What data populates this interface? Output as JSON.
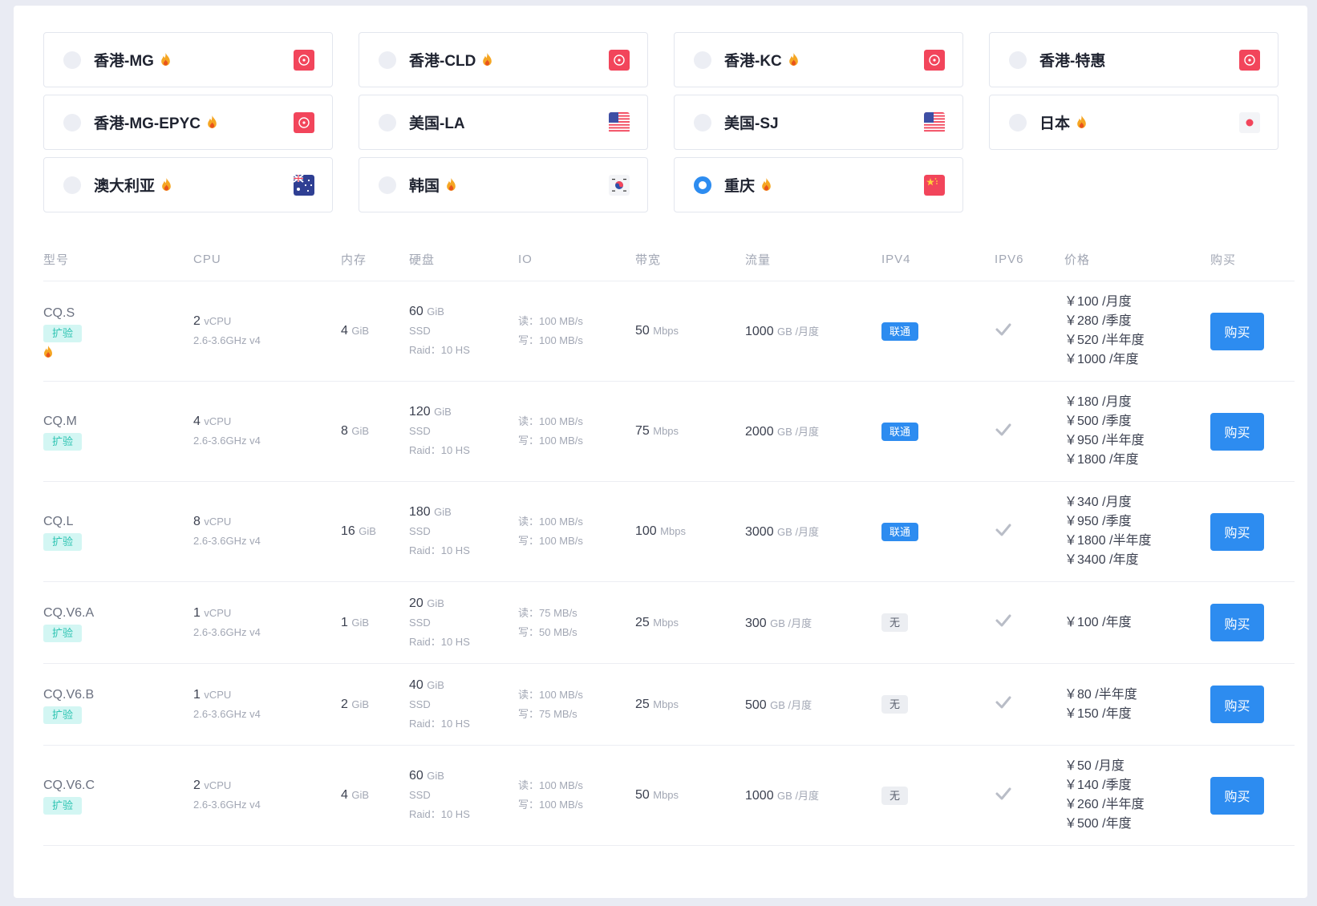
{
  "regions": [
    {
      "name": "香港-MG",
      "hot": true,
      "flag": "hk",
      "checked": false
    },
    {
      "name": "香港-CLD",
      "hot": true,
      "flag": "hk",
      "checked": false
    },
    {
      "name": "香港-KC",
      "hot": true,
      "flag": "hk",
      "checked": false
    },
    {
      "name": "香港-特惠",
      "hot": false,
      "flag": "hk",
      "checked": false
    },
    {
      "name": "香港-MG-EPYC",
      "hot": true,
      "flag": "hk",
      "checked": false
    },
    {
      "name": "美国-LA",
      "hot": false,
      "flag": "us",
      "checked": false
    },
    {
      "name": "美国-SJ",
      "hot": false,
      "flag": "us",
      "checked": false
    },
    {
      "name": "日本",
      "hot": true,
      "flag": "jp",
      "checked": false
    },
    {
      "name": "澳大利亚",
      "hot": true,
      "flag": "au",
      "checked": false
    },
    {
      "name": "韩国",
      "hot": true,
      "flag": "kr",
      "checked": false
    },
    {
      "name": "重庆",
      "hot": true,
      "flag": "cn",
      "checked": true
    }
  ],
  "headers": {
    "model": "型号",
    "cpu": "CPU",
    "mem": "内存",
    "disk": "硬盘",
    "io": "IO",
    "bw": "带宽",
    "traffic": "流量",
    "ipv4": "IPV4",
    "ipv6": "IPV6",
    "price": "价格",
    "buy": "购买"
  },
  "plans": [
    {
      "model": "CQ.S",
      "tag": "扩验",
      "hot": true,
      "cpu": "2",
      "cpu_unit": "vCPU",
      "cpu_freq": "2.6-3.6GHz v4",
      "mem": "4",
      "mem_unit": "GiB",
      "disk": "60",
      "disk_unit": "GiB",
      "disk_type": "SSD",
      "raid": "Raid：10 HS",
      "io_read": "读：100 MB/s",
      "io_write": "写：100 MB/s",
      "bw": "50",
      "bw_unit": "Mbps",
      "traffic": "1000",
      "traffic_unit": "GB /月度",
      "ipv4": "联通",
      "ipv4_type": "isp",
      "ipv6": true,
      "prices": [
        "￥100 /月度",
        "￥280 /季度",
        "￥520 /半年度",
        "￥1000 /年度"
      ],
      "buy": "购买"
    },
    {
      "model": "CQ.M",
      "tag": "扩验",
      "hot": false,
      "cpu": "4",
      "cpu_unit": "vCPU",
      "cpu_freq": "2.6-3.6GHz v4",
      "mem": "8",
      "mem_unit": "GiB",
      "disk": "120",
      "disk_unit": "GiB",
      "disk_type": "SSD",
      "raid": "Raid：10 HS",
      "io_read": "读：100 MB/s",
      "io_write": "写：100 MB/s",
      "bw": "75",
      "bw_unit": "Mbps",
      "traffic": "2000",
      "traffic_unit": "GB /月度",
      "ipv4": "联通",
      "ipv4_type": "isp",
      "ipv6": true,
      "prices": [
        "￥180 /月度",
        "￥500 /季度",
        "￥950 /半年度",
        "￥1800 /年度"
      ],
      "buy": "购买"
    },
    {
      "model": "CQ.L",
      "tag": "扩验",
      "hot": false,
      "cpu": "8",
      "cpu_unit": "vCPU",
      "cpu_freq": "2.6-3.6GHz v4",
      "mem": "16",
      "mem_unit": "GiB",
      "disk": "180",
      "disk_unit": "GiB",
      "disk_type": "SSD",
      "raid": "Raid：10 HS",
      "io_read": "读：100 MB/s",
      "io_write": "写：100 MB/s",
      "bw": "100",
      "bw_unit": "Mbps",
      "traffic": "3000",
      "traffic_unit": "GB /月度",
      "ipv4": "联通",
      "ipv4_type": "isp",
      "ipv6": true,
      "prices": [
        "￥340 /月度",
        "￥950 /季度",
        "￥1800 /半年度",
        "￥3400 /年度"
      ],
      "buy": "购买"
    },
    {
      "model": "CQ.V6.A",
      "tag": "扩验",
      "hot": false,
      "cpu": "1",
      "cpu_unit": "vCPU",
      "cpu_freq": "2.6-3.6GHz v4",
      "mem": "1",
      "mem_unit": "GiB",
      "disk": "20",
      "disk_unit": "GiB",
      "disk_type": "SSD",
      "raid": "Raid：10 HS",
      "io_read": "读：75 MB/s",
      "io_write": "写：50 MB/s",
      "bw": "25",
      "bw_unit": "Mbps",
      "traffic": "300",
      "traffic_unit": "GB /月度",
      "ipv4": "无",
      "ipv4_type": "none",
      "ipv6": true,
      "prices": [
        "￥100 /年度"
      ],
      "buy": "购买"
    },
    {
      "model": "CQ.V6.B",
      "tag": "扩验",
      "hot": false,
      "cpu": "1",
      "cpu_unit": "vCPU",
      "cpu_freq": "2.6-3.6GHz v4",
      "mem": "2",
      "mem_unit": "GiB",
      "disk": "40",
      "disk_unit": "GiB",
      "disk_type": "SSD",
      "raid": "Raid：10 HS",
      "io_read": "读：100 MB/s",
      "io_write": "写：75 MB/s",
      "bw": "25",
      "bw_unit": "Mbps",
      "traffic": "500",
      "traffic_unit": "GB /月度",
      "ipv4": "无",
      "ipv4_type": "none",
      "ipv6": true,
      "prices": [
        "￥80 /半年度",
        "￥150 /年度"
      ],
      "buy": "购买"
    },
    {
      "model": "CQ.V6.C",
      "tag": "扩验",
      "hot": false,
      "cpu": "2",
      "cpu_unit": "vCPU",
      "cpu_freq": "2.6-3.6GHz v4",
      "mem": "4",
      "mem_unit": "GiB",
      "disk": "60",
      "disk_unit": "GiB",
      "disk_type": "SSD",
      "raid": "Raid：10 HS",
      "io_read": "读：100 MB/s",
      "io_write": "写：100 MB/s",
      "bw": "50",
      "bw_unit": "Mbps",
      "traffic": "1000",
      "traffic_unit": "GB /月度",
      "ipv4": "无",
      "ipv4_type": "none",
      "ipv6": true,
      "prices": [
        "￥50 /月度",
        "￥140 /季度",
        "￥260 /半年度",
        "￥500 /年度"
      ],
      "buy": "购买"
    }
  ],
  "colors": {
    "accent": "#2d8cf0",
    "tag_bg": "#d3f6f3",
    "tag_text": "#2ec4b2",
    "fire": "#f5a623"
  }
}
